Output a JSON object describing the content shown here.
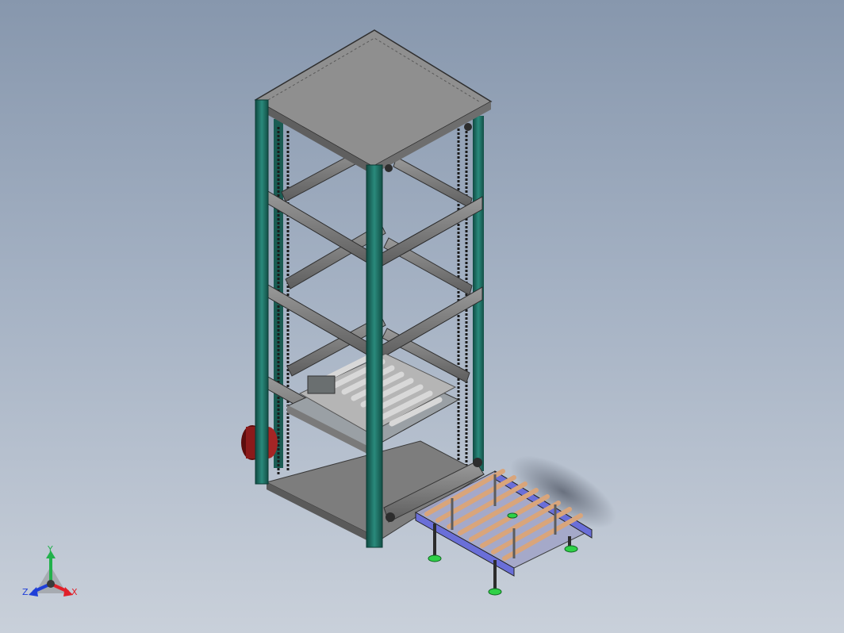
{
  "triad": {
    "x_label": "X",
    "y_label": "Y",
    "z_label": "Z",
    "x_color": "#e0202a",
    "y_color": "#22b14c",
    "z_color": "#1f3fd8"
  },
  "colors": {
    "background_top": "#8797ad",
    "background_bottom": "#c9d0da",
    "column": "#1e6b60",
    "frame_steel": "#7c7c7c",
    "roller": "#c9c9c9",
    "wood_roller": "#d9a57b",
    "conveyor_frame": "#6a6fd8",
    "foot_pad": "#2fd147",
    "motor": "#8b1a1a"
  },
  "icons": {
    "triad": "coordinate-axes-icon"
  }
}
